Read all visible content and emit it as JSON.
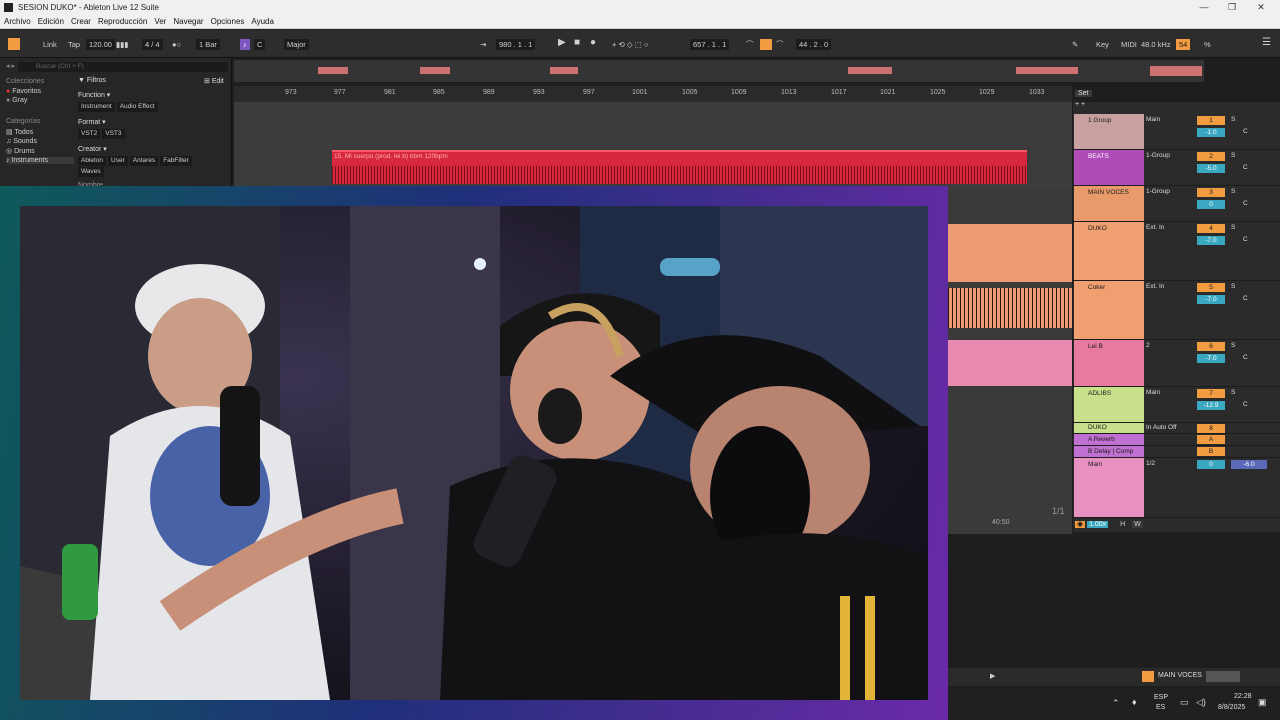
{
  "window": {
    "title": "SESION DUKO* - Ableton Live 12 Suite",
    "controls": [
      "—",
      "❐",
      "✕"
    ]
  },
  "menu": [
    "Archivo",
    "Edición",
    "Crear",
    "Reproducción",
    "Ver",
    "Navegar",
    "Opciones",
    "Ayuda"
  ],
  "control_bar": {
    "link": "Link",
    "tap": "Tap",
    "tempo": "120.00",
    "signature": "4 / 4",
    "quantize": "1 Bar",
    "key": "C",
    "scale": "Major",
    "position": "980 .   1 .   1",
    "loop_start": "657 .   1 .   1",
    "loop_length": "44 .   2 .   0",
    "key_map": "Key",
    "midi": "MIDI",
    "sample_rate": "48.0 kHz",
    "cpu": "54",
    "cpu_unit": "%"
  },
  "browser": {
    "search_placeholder": "Buscar (Ctrl + F)",
    "filters": "Filtros",
    "edit": "Edit",
    "collections_header": "Colecciones",
    "collections": [
      "Favoritos",
      "Gray"
    ],
    "categories_header": "Categorías",
    "categories": [
      "Todos",
      "Sounds",
      "Drums",
      "Instruments"
    ],
    "function_label": "Function",
    "function_tags": [
      "Instrument",
      "Audio Effect"
    ],
    "format_label": "Format",
    "format_tags": [
      "VST2",
      "VST3"
    ],
    "creator_label": "Creator",
    "creator_tags": [
      "Ableton",
      "User",
      "Antares",
      "FabFilter"
    ],
    "creator_tags2": [
      "Waves"
    ],
    "name_header": "Nombre"
  },
  "ruler": {
    "ticks": [
      "973",
      "977",
      "981",
      "985",
      "989",
      "993",
      "997",
      "1001",
      "1005",
      "1009",
      "1013",
      "1017",
      "1021",
      "1025",
      "1029",
      "1033"
    ]
  },
  "beats_clip": {
    "label": "15. Mi cuerpo (prod. lei b) bbm 120bpm"
  },
  "arrangement_right": {
    "page": "1/1",
    "time": "40:50",
    "zoom": "1.00x",
    "h": "H",
    "w": "W"
  },
  "mixer": {
    "set_label": "Set",
    "tracks": [
      {
        "name": "1 Group",
        "route": "Main",
        "num": "1",
        "vol": "-1.0",
        "color": "#c8a0a0"
      },
      {
        "name": "BEATS",
        "route": "1-Group",
        "num": "2",
        "vol": "-5.0",
        "color": "#b04cb8"
      },
      {
        "name": "MAIN VOCES",
        "route": "1-Group",
        "num": "3",
        "vol": "0",
        "color": "#e89a6a"
      },
      {
        "name": "DUKO",
        "route": "Ext. In",
        "num": "4",
        "vol": "-7.0",
        "color": "#f0a070"
      },
      {
        "name": "Coker",
        "route": "Ext. In",
        "num": "5",
        "vol": "-7.0",
        "color": "#f0a070"
      },
      {
        "name": "Lei B",
        "route": "2",
        "num": "6",
        "vol": "-7.0",
        "color": "#e87aa0"
      },
      {
        "name": "ADLIBS",
        "route": "Main",
        "num": "7",
        "vol": "-12.9",
        "color": "#c8e08c"
      },
      {
        "name": "DUKO",
        "route": "In Auto Off",
        "num": "8",
        "vol": "",
        "color": "#c8e08c"
      },
      {
        "name": "A Reverb",
        "route": "",
        "num": "A",
        "vol": "",
        "color": "#c070d0"
      },
      {
        "name": "B Delay | Comp",
        "route": "",
        "num": "B",
        "vol": "",
        "color": "#c070d0"
      },
      {
        "name": "Main",
        "route": "1/2",
        "num": "0",
        "vol": "-6.0",
        "color": "#e890c0"
      }
    ]
  },
  "bottom_bar": {
    "selected_track": "MAIN VOCES"
  },
  "taskbar": {
    "lang": "ESP",
    "region": "ES",
    "time": "22:28",
    "date": "8/8/2025"
  }
}
